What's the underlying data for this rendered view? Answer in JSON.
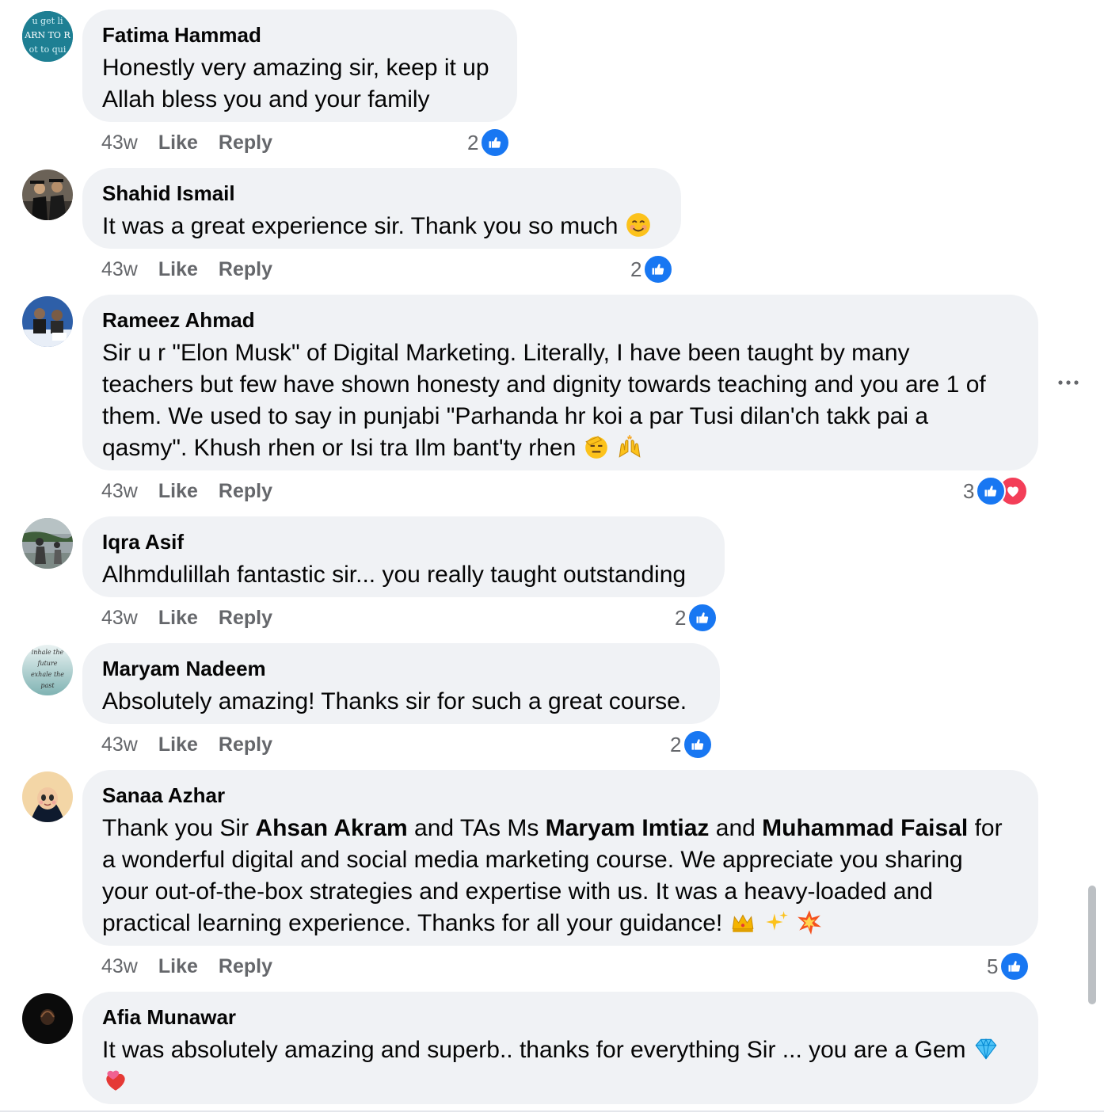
{
  "comments": [
    {
      "author": "Fatima Hammad",
      "lines": [
        "Honestly very amazing sir, keep it up",
        "Allah bless you and your family"
      ],
      "avatar_text": [
        "u get li",
        "ARN TO R",
        "ot to qui"
      ],
      "time": "43w",
      "like": "Like",
      "reply": "Reply",
      "reaction_count": "2",
      "reactions": [
        "like"
      ]
    },
    {
      "author": "Shahid Ismail",
      "text": "It was a great experience sir. Thank you so much",
      "emojis": [
        "smiling-face-emoji"
      ],
      "time": "43w",
      "like": "Like",
      "reply": "Reply",
      "reaction_count": "2",
      "reactions": [
        "like"
      ]
    },
    {
      "author": "Rameez Ahmad",
      "lines": [
        "Sir u r \"Elon Musk\" of Digital Marketing. Literally, I have been taught by many",
        "teachers but few have shown honesty and dignity towards teaching and you are 1 of",
        "them. We used to say in punjabi \"Parhanda hr koi a par Tusi dilan'ch takk pai a",
        "qasmy\". Khush rhen or Isi tra Ilm bant'ty rhen"
      ],
      "emojis": [
        "saluting-face-emoji",
        "raising-hands-emoji"
      ],
      "time": "43w",
      "like": "Like",
      "reply": "Reply",
      "reaction_count": "3",
      "reactions": [
        "like",
        "love"
      ]
    },
    {
      "author": "Iqra Asif",
      "text": "Alhmdulillah fantastic sir... you really taught outstanding",
      "time": "43w",
      "like": "Like",
      "reply": "Reply",
      "reaction_count": "2",
      "reactions": [
        "like"
      ]
    },
    {
      "author": "Maryam Nadeem",
      "text": "Absolutely amazing! Thanks sir for such a great course.",
      "avatar_text": [
        "inhale the",
        "future",
        "exhale the",
        "past"
      ],
      "time": "43w",
      "like": "Like",
      "reply": "Reply",
      "reaction_count": "2",
      "reactions": [
        "like"
      ]
    },
    {
      "author": "Sanaa Azhar",
      "line1": {
        "a": "Thank you Sir ",
        "b": "Ahsan Akram",
        "c": " and TAs Ms ",
        "d": "Maryam Imtiaz",
        "e": " and ",
        "f": "Muhammad Faisal",
        "g": " for"
      },
      "lines": [
        "a wonderful digital and social media marketing course. We appreciate you sharing",
        "your out-of-the-box strategies and expertise with us. It was a heavy-loaded and",
        "practical learning experience. Thanks for all your guidance!"
      ],
      "emojis": [
        "crown-emoji",
        "sparkles-emoji",
        "collision-emoji"
      ],
      "time": "43w",
      "like": "Like",
      "reply": "Reply",
      "reaction_count": "5",
      "reactions": [
        "like"
      ]
    },
    {
      "author": "Afia Munawar",
      "text": "It was absolutely amazing and superb.. thanks for everything Sir ... you are a Gem",
      "emojis": [
        "gem-stone-emoji",
        "heart-exclamation-emoji"
      ]
    }
  ],
  "more_options_icon": "more-horizontal-icon",
  "colors": {
    "bubble": "#f0f2f5",
    "like_blue": "#1877f2",
    "love_red": "#f33e58",
    "meta_gray": "#65676b"
  }
}
